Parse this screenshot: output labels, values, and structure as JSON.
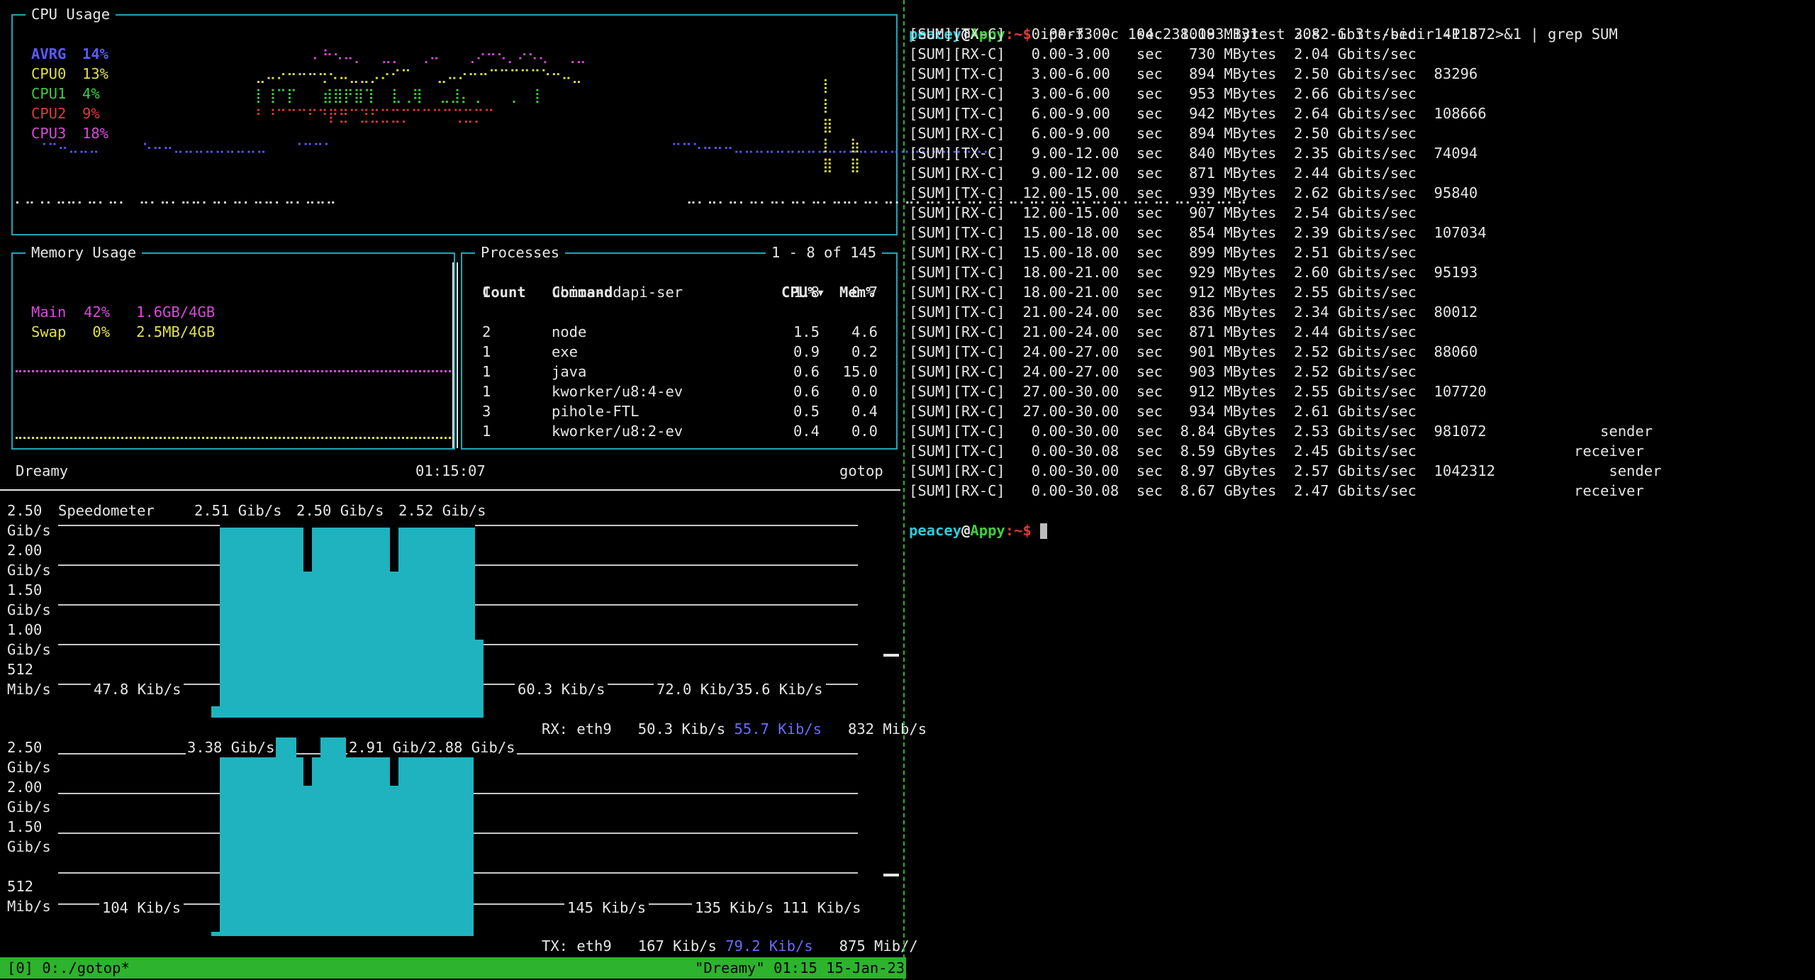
{
  "colors": {
    "accent_cyan": "#1fa6b8",
    "bar_fill": "#1fb3bf",
    "status_green": "#2db32d",
    "prompt_user": "#33c9d6",
    "prompt_host": "#3ecf3e",
    "prompt_path": "#e03a3a"
  },
  "cpu": {
    "title": "CPU Usage",
    "rows": [
      {
        "label": "AVRG",
        "value": "14%",
        "color": "#5a5aff"
      },
      {
        "label": "CPU0",
        "value": "13%",
        "color": "#e0e04a"
      },
      {
        "label": "CPU1",
        "value": "4%",
        "color": "#3ecf3e"
      },
      {
        "label": "CPU2",
        "value": "9%",
        "color": "#e03a3a"
      },
      {
        "label": "CPU3",
        "value": "18%",
        "color": "#d94ad9"
      }
    ]
  },
  "memory": {
    "title": "Memory Usage",
    "main": {
      "label": "Main",
      "percent": "42%",
      "amount": "1.6GB/4GB"
    },
    "swap": {
      "label": "Swap",
      "percent": "0%",
      "amount": "2.5MB/4GB"
    }
  },
  "processes": {
    "title": "Processes",
    "range": "1 - 8 of 145",
    "headers": {
      "count": "Count",
      "command": "Command",
      "cpu": "CPU%▾",
      "mem": "Mem%"
    },
    "rows": [
      {
        "count": "1",
        "command": "ubios-udapi-ser",
        "cpu": "1.8",
        "mem": "0.7"
      },
      {
        "count": "",
        "command": "",
        "cpu": "",
        "mem": ""
      },
      {
        "count": "2",
        "command": "node",
        "cpu": "1.5",
        "mem": "4.6"
      },
      {
        "count": "1",
        "command": "exe",
        "cpu": "0.9",
        "mem": "0.2"
      },
      {
        "count": "1",
        "command": "java",
        "cpu": "0.6",
        "mem": "15.0"
      },
      {
        "count": "1",
        "command": "kworker/u8:4-ev",
        "cpu": "0.6",
        "mem": "0.0"
      },
      {
        "count": "3",
        "command": "pihole-FTL",
        "cpu": "0.5",
        "mem": "0.4"
      },
      {
        "count": "1",
        "command": "kworker/u8:2-ev",
        "cpu": "0.4",
        "mem": "0.0"
      }
    ]
  },
  "footer": {
    "host": "Dreamy",
    "time": "01:15:07",
    "app": "gotop"
  },
  "net_rx": {
    "title": "Speedometer",
    "peaks": [
      "2.51 Gib/s",
      "2.50 Gib/s",
      "2.52 Gib/s"
    ],
    "ylabels": [
      [
        "2.50",
        "Gib/s"
      ],
      [
        "2.00",
        "Gib/s"
      ],
      [
        "1.50",
        "Gib/s"
      ],
      [
        "1.00",
        "Gib/s"
      ],
      [
        "512",
        "Mib/s"
      ]
    ],
    "low_left": "47.8 Kib/s",
    "low_mid": "60.3 Kib/s",
    "low_right": "72.0 Kib/35.6 Kib/s",
    "iface": "RX: eth9",
    "current": "50.3 Kib/s",
    "avg": "55.7 Kib/s",
    "max": "832 Mib/s"
  },
  "net_tx": {
    "peak_left": "3.38 Gib/s",
    "peak_right": "2.91 Gib/2.88 Gib/s",
    "ylabels": [
      [
        "2.50",
        "Gib/s"
      ],
      [
        "2.00",
        "Gib/s"
      ],
      [
        "1.50",
        "Gib/s"
      ],
      [
        "512",
        "Mib/s"
      ]
    ],
    "low_left": "104 Kib/s",
    "low_mid": "145 Kib/s",
    "low_right": "135 Kib/s 111 Kib/s",
    "iface": "TX: eth9",
    "current": "167 Kib/s",
    "avg": "79.2 Kib/s",
    "max": "875 Mib//"
  },
  "tmux": {
    "window": "[0] 0:./gotop*",
    "right": "\"Dreamy\" 01:15 15-Jan-23"
  },
  "terminal": {
    "prompt_user": "peacey",
    "prompt_at": "@",
    "prompt_host": "Appy",
    "prompt_path": ":~$",
    "command": " iperf3 -c 104.238.183.131 -t 30s -i 3 --bidir -P 8 2>&1 | grep SUM",
    "lines": [
      "[SUM][TX-C]   0.00-3.00   sec  1009 MBytes  2.82 Gbits/sec  141157",
      "[SUM][RX-C]   0.00-3.00   sec   730 MBytes  2.04 Gbits/sec",
      "[SUM][TX-C]   3.00-6.00   sec   894 MBytes  2.50 Gbits/sec  83296",
      "[SUM][RX-C]   3.00-6.00   sec   953 MBytes  2.66 Gbits/sec",
      "[SUM][TX-C]   6.00-9.00   sec   942 MBytes  2.64 Gbits/sec  108666",
      "[SUM][RX-C]   6.00-9.00   sec   894 MBytes  2.50 Gbits/sec",
      "[SUM][TX-C]   9.00-12.00  sec   840 MBytes  2.35 Gbits/sec  74094",
      "[SUM][RX-C]   9.00-12.00  sec   871 MBytes  2.44 Gbits/sec",
      "[SUM][TX-C]  12.00-15.00  sec   939 MBytes  2.62 Gbits/sec  95840",
      "[SUM][RX-C]  12.00-15.00  sec   907 MBytes  2.54 Gbits/sec",
      "[SUM][TX-C]  15.00-18.00  sec   854 MBytes  2.39 Gbits/sec  107034",
      "[SUM][RX-C]  15.00-18.00  sec   899 MBytes  2.51 Gbits/sec",
      "[SUM][TX-C]  18.00-21.00  sec   929 MBytes  2.60 Gbits/sec  95193",
      "[SUM][RX-C]  18.00-21.00  sec   912 MBytes  2.55 Gbits/sec",
      "[SUM][TX-C]  21.00-24.00  sec   836 MBytes  2.34 Gbits/sec  80012",
      "[SUM][RX-C]  21.00-24.00  sec   871 MBytes  2.44 Gbits/sec",
      "[SUM][TX-C]  24.00-27.00  sec   901 MBytes  2.52 Gbits/sec  88060",
      "[SUM][RX-C]  24.00-27.00  sec   903 MBytes  2.52 Gbits/sec",
      "[SUM][TX-C]  27.00-30.00  sec   912 MBytes  2.55 Gbits/sec  107720",
      "[SUM][RX-C]  27.00-30.00  sec   934 MBytes  2.61 Gbits/sec",
      "[SUM][TX-C]   0.00-30.00  sec  8.84 GBytes  2.53 Gbits/sec  981072             sender",
      "[SUM][TX-C]   0.00-30.08  sec  8.59 GBytes  2.45 Gbits/sec                  receiver",
      "[SUM][RX-C]   0.00-30.00  sec  8.97 GBytes  2.57 Gbits/sec  1042312             sender",
      "[SUM][RX-C]   0.00-30.08  sec  8.67 GBytes  2.47 Gbits/sec                  receiver"
    ]
  }
}
